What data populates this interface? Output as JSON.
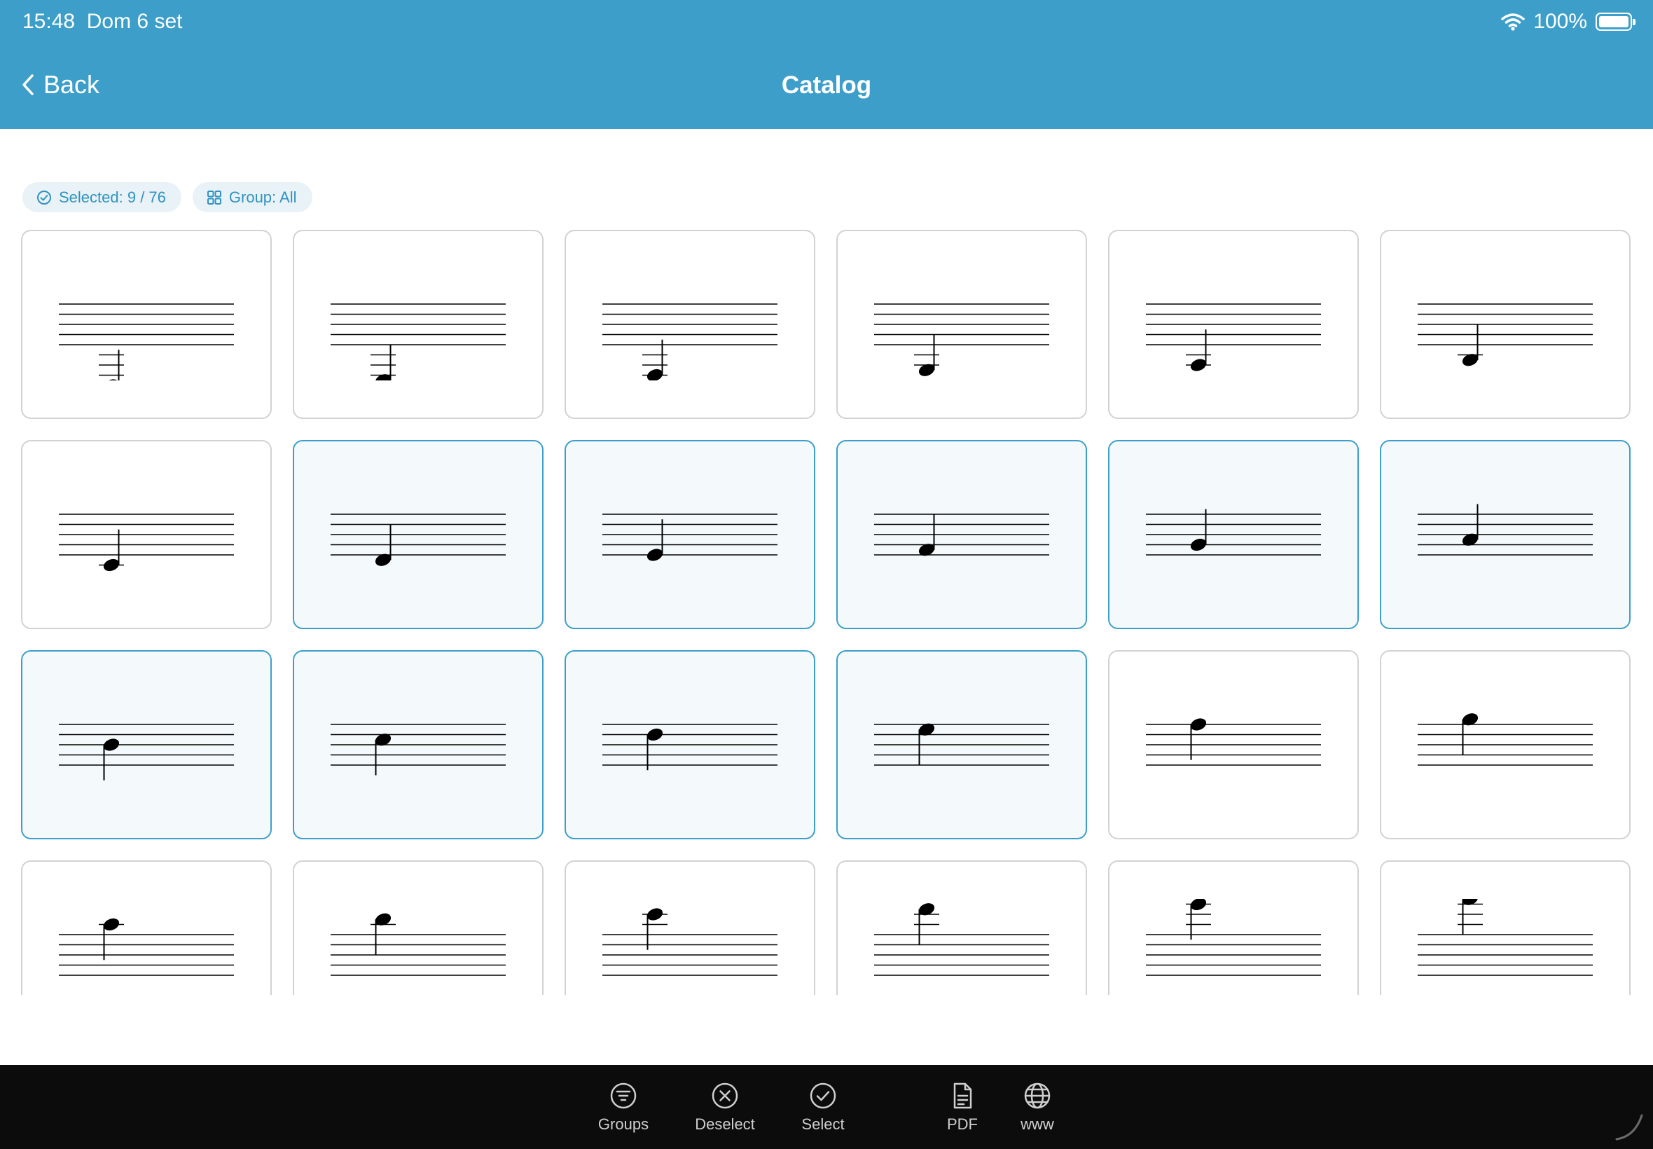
{
  "status": {
    "time": "15:48",
    "date": "Dom 6 set",
    "battery": "100%",
    "battery_level": 1.0
  },
  "nav": {
    "back_label": "Back",
    "title": "Catalog"
  },
  "chips": {
    "selected": "Selected: 9 / 76",
    "group": "Group: All"
  },
  "notes": [
    {
      "pos": -8,
      "selected": false
    },
    {
      "pos": -7,
      "selected": false
    },
    {
      "pos": -6,
      "selected": false
    },
    {
      "pos": -5,
      "selected": false
    },
    {
      "pos": -4,
      "selected": false
    },
    {
      "pos": -3,
      "selected": false
    },
    {
      "pos": -2,
      "selected": false
    },
    {
      "pos": -1,
      "selected": true
    },
    {
      "pos": 0,
      "selected": true
    },
    {
      "pos": 1,
      "selected": true
    },
    {
      "pos": 2,
      "selected": true
    },
    {
      "pos": 3,
      "selected": true
    },
    {
      "pos": 4,
      "selected": true
    },
    {
      "pos": 5,
      "selected": true
    },
    {
      "pos": 6,
      "selected": true
    },
    {
      "pos": 7,
      "selected": true
    },
    {
      "pos": 8,
      "selected": false
    },
    {
      "pos": 9,
      "selected": false
    },
    {
      "pos": 10,
      "selected": false
    },
    {
      "pos": 11,
      "selected": false
    },
    {
      "pos": 12,
      "selected": false
    },
    {
      "pos": 13,
      "selected": false
    },
    {
      "pos": 14,
      "selected": false
    },
    {
      "pos": 15,
      "selected": false
    }
  ],
  "tabs": [
    {
      "label": "Groups",
      "icon": "groups-icon"
    },
    {
      "label": "Deselect",
      "icon": "deselect-icon"
    },
    {
      "label": "Select",
      "icon": "select-icon"
    },
    {
      "label": "PDF",
      "icon": "pdf-icon"
    },
    {
      "label": "www",
      "icon": "globe-icon"
    }
  ],
  "colors": {
    "header": "#3d9fc9",
    "accent": "#3d9fc9",
    "selected_bg": "#f4f9fb",
    "tabbar": "#0c0c0c"
  }
}
